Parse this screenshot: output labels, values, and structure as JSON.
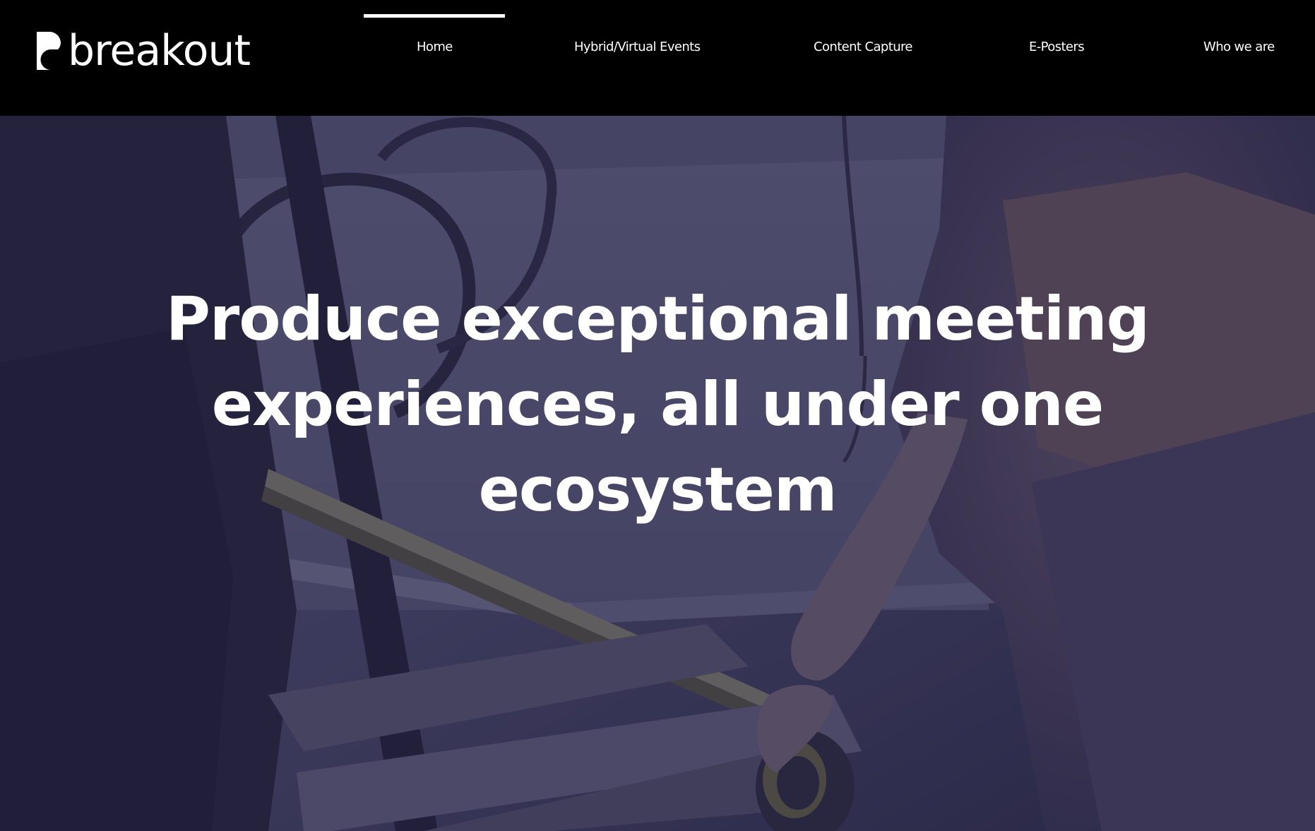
{
  "header": {
    "logo_text": "breakout",
    "nav": [
      {
        "label": "Home",
        "active": true
      },
      {
        "label": "Hybrid/Virtual Events",
        "active": false
      },
      {
        "label": "Content Capture",
        "active": false
      },
      {
        "label": "E-Posters",
        "active": false
      },
      {
        "label": "Who we are",
        "active": false
      }
    ]
  },
  "hero": {
    "heading": "Produce exceptional meeting experiences, all under one ecosystem"
  },
  "colors": {
    "header_bg": "#000000",
    "text": "#ffffff",
    "hero_tint": "#28264a"
  }
}
